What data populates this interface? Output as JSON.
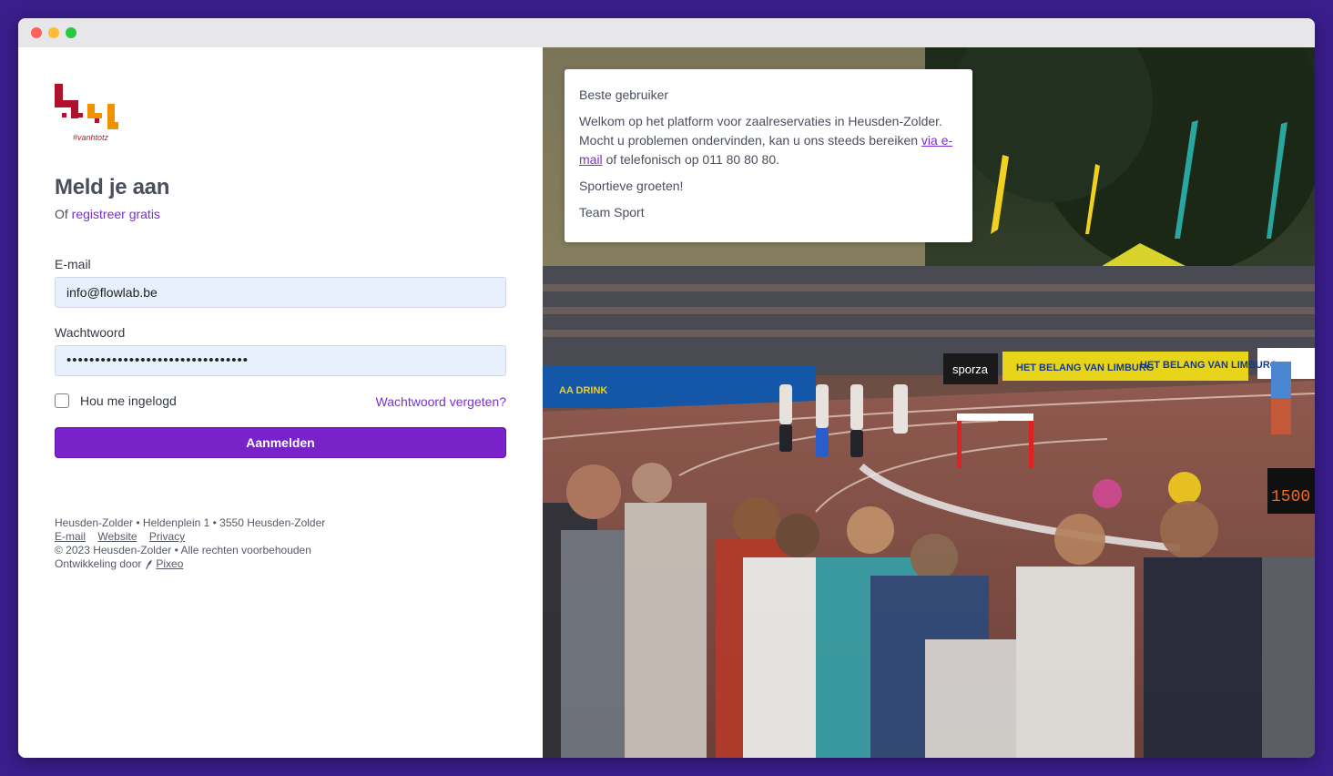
{
  "login": {
    "logo_tag": "#vanhtotz",
    "title": "Meld je aan",
    "subtitle_prefix": "Of",
    "register_link": "registreer gratis",
    "email_label": "E-mail",
    "email_value": "info@flowlab.be",
    "password_label": "Wachtwoord",
    "password_value": "••••••••••••••••••••••••••••••••",
    "remember_label": "Hou me ingelogd",
    "forgot_link": "Wachtwoord vergeten?",
    "submit_label": "Aanmelden"
  },
  "footer": {
    "address": "Heusden-Zolder • Heldenplein 1 • 3550 Heusden-Zolder",
    "links": [
      "E-mail",
      "Website",
      "Privacy"
    ],
    "copyright": "© 2023 Heusden-Zolder • Alle rechten voorbehouden",
    "dev_prefix": "Ontwikkeling door",
    "dev_link": "Pixeo"
  },
  "notice": {
    "greeting": "Beste gebruiker",
    "body_1": "Welkom op het platform voor zaalreservaties in Heusden-Zolder. Mocht u problemen ondervinden, kan u ons steeds bereiken",
    "email_link": "via e-mail",
    "body_2": "of telefonisch op 011 80 80 80.",
    "closing": "Sportieve groeten!",
    "signature": "Team Sport"
  },
  "photo": {
    "banner_1": "HET BELANG VAN LIMBURG",
    "banner_2": "HET BELANG VAN LIMBURG",
    "sporza": "sporza",
    "aa_drink": "AA DRINK",
    "scoreboard": "1500"
  },
  "colors": {
    "accent": "#7a22c9",
    "frame": "#3a1e8c",
    "logo_red": "#b0122d",
    "logo_orange": "#f29100"
  }
}
